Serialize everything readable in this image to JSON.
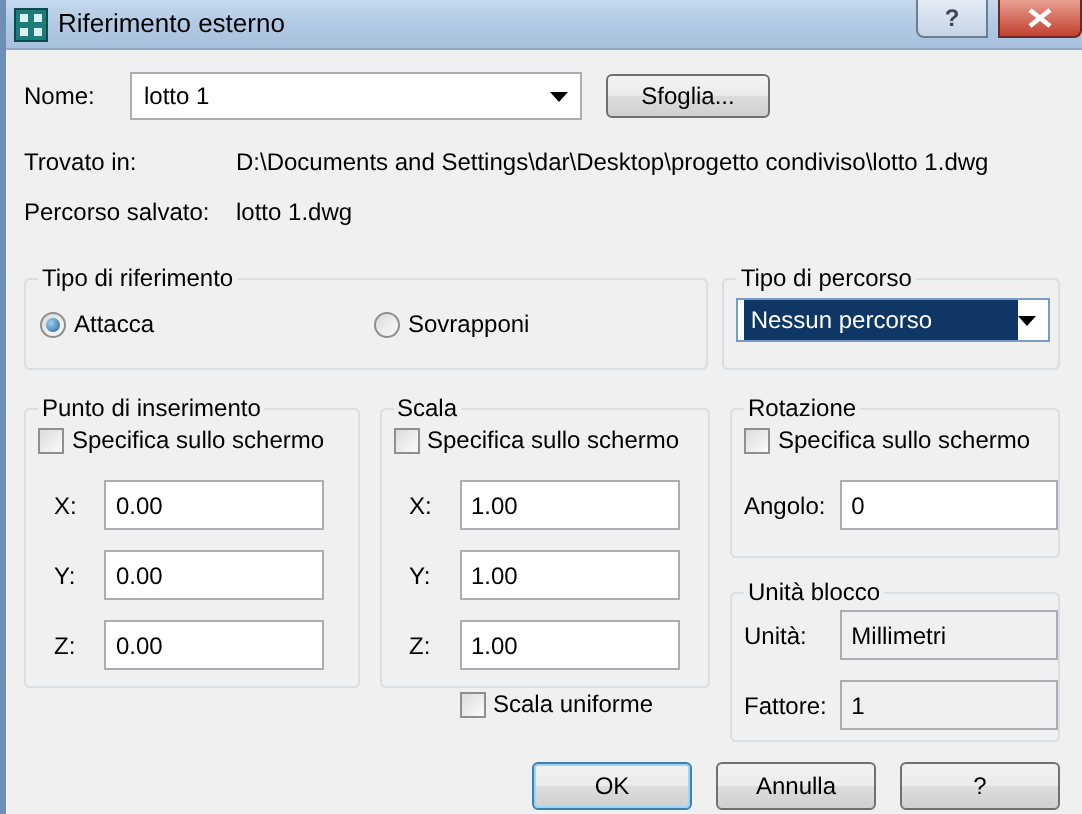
{
  "window": {
    "title": "Riferimento esterno",
    "help_button": "?"
  },
  "name": {
    "label": "Nome:",
    "value": "lotto 1"
  },
  "browse_button": "Sfoglia...",
  "found_in": {
    "label": "Trovato in:",
    "value": "D:\\Documents and Settings\\dar\\Desktop\\progetto condiviso\\lotto 1.dwg"
  },
  "saved_path": {
    "label": "Percorso salvato:",
    "value": "lotto 1.dwg"
  },
  "reference_type": {
    "title": "Tipo di riferimento",
    "options": [
      {
        "label": "Attacca",
        "selected": true
      },
      {
        "label": "Sovrapponi",
        "selected": false
      }
    ]
  },
  "path_type": {
    "title": "Tipo di percorso",
    "value": "Nessun percorso",
    "focused": true
  },
  "insertion_point": {
    "title": "Punto di inserimento",
    "checkbox": {
      "label": "Specifica sullo schermo",
      "checked": false
    },
    "fields": [
      {
        "label": "X:",
        "value": "0.00"
      },
      {
        "label": "Y:",
        "value": "0.00"
      },
      {
        "label": "Z:",
        "value": "0.00"
      }
    ]
  },
  "scale": {
    "title": "Scala",
    "checkbox": {
      "label": "Specifica sullo schermo",
      "checked": false
    },
    "fields": [
      {
        "label": "X:",
        "value": "1.00"
      },
      {
        "label": "Y:",
        "value": "1.00"
      },
      {
        "label": "Z:",
        "value": "1.00"
      }
    ],
    "uniform": {
      "label": "Scala uniforme",
      "checked": false
    }
  },
  "rotation": {
    "title": "Rotazione",
    "checkbox": {
      "label": "Specifica sullo schermo",
      "checked": false
    },
    "fields": [
      {
        "label": "Angolo:",
        "value": "0"
      }
    ]
  },
  "block_units": {
    "title": "Unità blocco",
    "fields": [
      {
        "label": "Unità:",
        "value": "Millimetri",
        "disabled": true
      },
      {
        "label": "Fattore:",
        "value": "1",
        "disabled": true
      }
    ]
  },
  "buttons": [
    {
      "label": "OK",
      "default": true
    },
    {
      "label": "Annulla",
      "default": false
    },
    {
      "label": "?",
      "default": false
    }
  ]
}
